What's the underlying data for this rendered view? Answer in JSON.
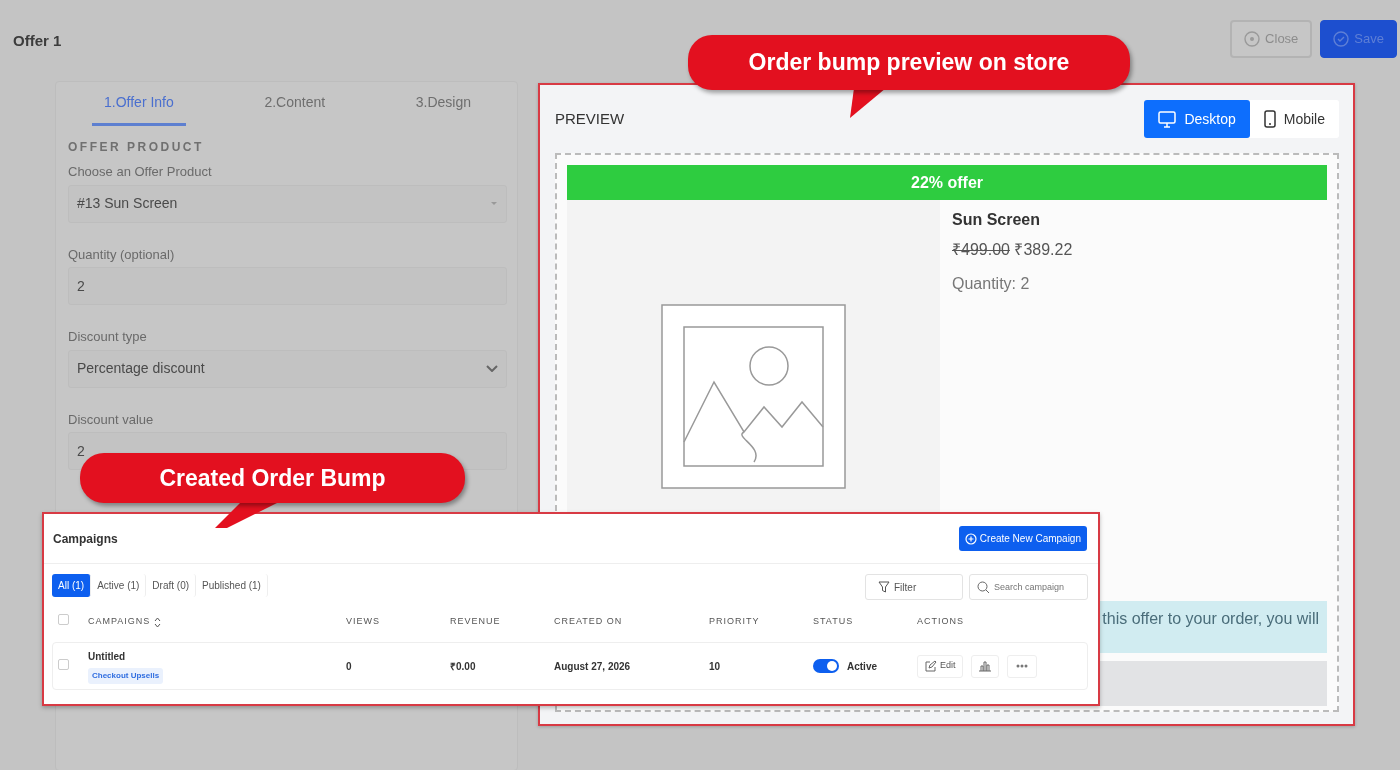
{
  "page": {
    "title": "Offer 1",
    "buttons": [
      {
        "label": "Close",
        "kind": "secondary"
      },
      {
        "label": "Save",
        "kind": "primary"
      }
    ]
  },
  "offer_form": {
    "tabs": [
      {
        "label": "1.Offer Info",
        "selected": true
      },
      {
        "label": "2.Content",
        "selected": false
      },
      {
        "label": "3.Design",
        "selected": false
      }
    ],
    "section_title": "OFFER PRODUCT",
    "fields": [
      {
        "label": "Choose an Offer Product",
        "value": "#13 Sun Screen",
        "kind": "combobox"
      },
      {
        "label": "Quantity (optional)",
        "value": "2",
        "kind": "input"
      },
      {
        "label": "Discount type",
        "value": "Percentage discount",
        "kind": "select"
      },
      {
        "label": "Discount value",
        "value": "2",
        "kind": "input"
      }
    ]
  },
  "preview": {
    "title": "PREVIEW",
    "devices": [
      {
        "label": "Desktop",
        "selected": true,
        "kind": "desktop"
      },
      {
        "label": "Mobile",
        "selected": false,
        "kind": "mobile"
      }
    ],
    "banner": "22% offer",
    "product_name": "Sun Screen",
    "original_price": "₹499.00",
    "price": "₹389.22",
    "quantity": "Quantity: 2",
    "offer_note": "this offer to your order, you will"
  },
  "campaigns": {
    "title": "Campaigns",
    "create_button": "Create New Campaign",
    "filters": [
      {
        "label": "All (1)",
        "selected": true
      },
      {
        "label": "Active (1)",
        "selected": false
      },
      {
        "label": "Draft (0)",
        "selected": false
      },
      {
        "label": "Published (1)",
        "selected": false
      }
    ],
    "filter_button": "Filter",
    "search": {
      "placeholder": "Search campaign"
    },
    "select_all": {
      "checked": false
    },
    "columns": [
      "CAMPAIGNS",
      "VIEWS",
      "REVENUE",
      "CREATED ON",
      "PRIORITY",
      "STATUS",
      "ACTIONS"
    ],
    "rows": [
      {
        "checked": false,
        "name": "Untitled",
        "tag": "Checkout Upsells",
        "views": "0",
        "revenue": "₹0.00",
        "created_on": "August 27, 2026",
        "priority": "10",
        "active": true,
        "status": "Active",
        "edit": "Edit"
      }
    ]
  },
  "callouts": [
    {
      "text": "Order bump preview on store"
    },
    {
      "text": "Created Order Bump"
    }
  ]
}
